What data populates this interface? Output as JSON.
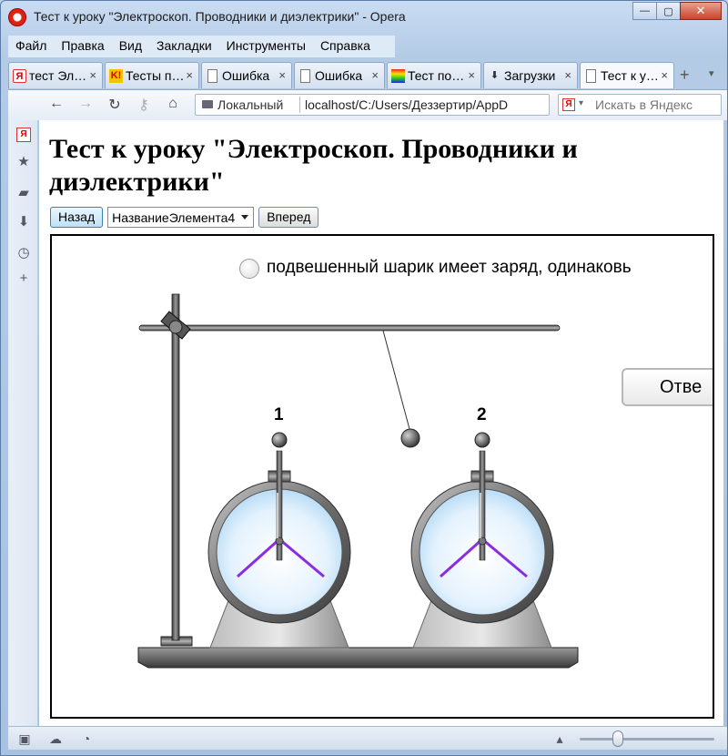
{
  "window": {
    "title": "Тест к уроку \"Электроскоп. Проводники и диэлектрики\" - Opera",
    "minimize": "—",
    "maximize": "▢",
    "close": "✕"
  },
  "menu": [
    "Файл",
    "Правка",
    "Вид",
    "Закладки",
    "Инструменты",
    "Справка"
  ],
  "tabs": [
    {
      "label": "тест Эл…",
      "icon": "yandex-icon",
      "glyph": "Я"
    },
    {
      "label": "Тесты п…",
      "icon": "k-icon",
      "glyph": "K!"
    },
    {
      "label": "Ошибка",
      "icon": "page-icon",
      "glyph": ""
    },
    {
      "label": "Ошибка",
      "icon": "page-icon",
      "glyph": ""
    },
    {
      "label": "Тест по…",
      "icon": "rainbow-icon",
      "glyph": ""
    },
    {
      "label": "Загрузки",
      "icon": "download-icon",
      "glyph": "⬇"
    },
    {
      "label": "Тест к у…",
      "icon": "page-icon",
      "glyph": "",
      "active": true
    }
  ],
  "tab_close": "×",
  "new_tab": "+",
  "nav": {
    "back": "←",
    "forward": "→",
    "reload": "↻",
    "key": "⚷",
    "home": "⌂",
    "location_chip": "Локальный",
    "url": "localhost/C:/Users/Деззертир/AppD",
    "search_placeholder": "Искать в Яндекс",
    "search_logo": "Я",
    "search_arrow": "▾"
  },
  "sidebar": [
    {
      "name": "yandex-icon",
      "glyph": "Я"
    },
    {
      "name": "star-icon",
      "glyph": "★"
    },
    {
      "name": "notes-icon",
      "glyph": "▰"
    },
    {
      "name": "downloads-icon",
      "glyph": "⬇"
    },
    {
      "name": "history-icon",
      "glyph": "◷"
    },
    {
      "name": "add-panel-icon",
      "glyph": "+"
    }
  ],
  "page": {
    "title": "Тест к уроку \"Электроскоп. Проводники и диэлектрики\"",
    "back_button": "Назад",
    "select_value": "НазваниеЭлемента4",
    "forward_button": "Вперед",
    "answer_option": "подвешенный шарик имеет заряд, одинаковь",
    "answer_button": "Отве",
    "electroscope_1": "1",
    "electroscope_2": "2"
  },
  "colors": {
    "leaf": "#8b2be2",
    "metal": "#6a6a6a",
    "glass": "#cfe7fb"
  },
  "statusbar": {
    "panel_icon": "▣",
    "cloud_icon": "☁",
    "speed_icon": "◔",
    "arrow_icon": "▴"
  }
}
